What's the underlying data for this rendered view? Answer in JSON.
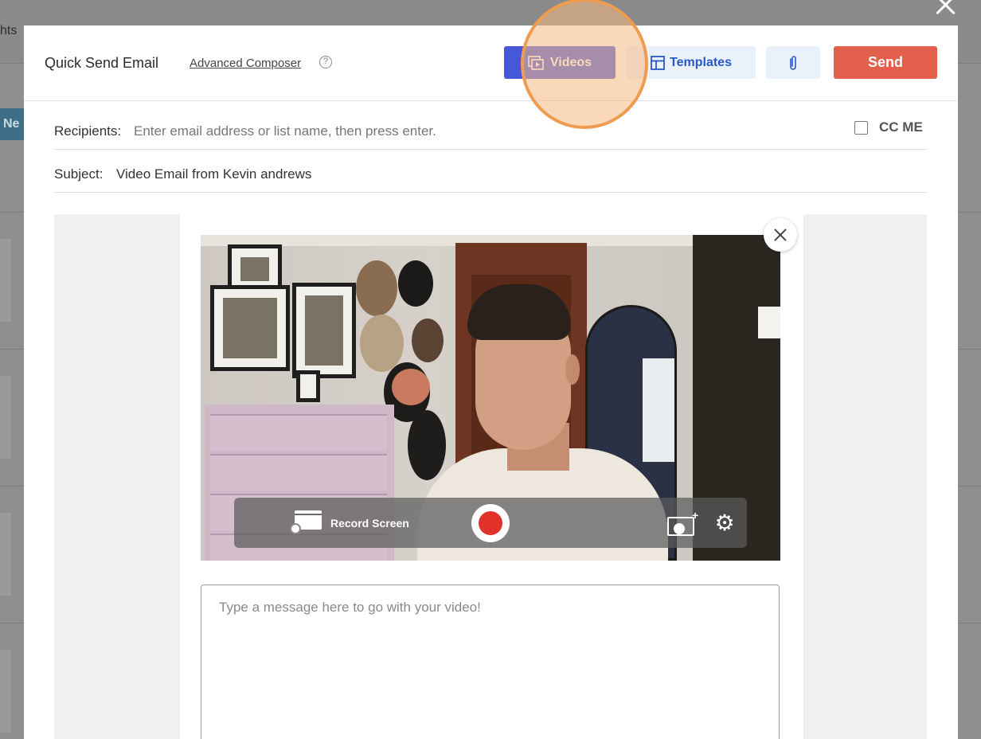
{
  "backdrop": {
    "tab_text": "hts",
    "new_button": "Ne"
  },
  "modal": {
    "title": "Quick Send Email",
    "advanced_link": "Advanced Composer",
    "help_symbol": "?",
    "buttons": {
      "videos": "Videos",
      "templates": "Templates",
      "send": "Send"
    },
    "recipients": {
      "label": "Recipients:",
      "placeholder": "Enter email address or list name, then press enter."
    },
    "cc_me_label": "CC ME",
    "subject": {
      "label": "Subject:",
      "value": "Video Email from Kevin andrews"
    },
    "recorder": {
      "record_screen_label": "Record Screen"
    },
    "message": {
      "placeholder": "Type a message here to go with your video!"
    }
  },
  "icons": {
    "videos": "video-icon",
    "templates": "layout-icon",
    "attach": "paperclip-icon",
    "record_screen": "screen-record-icon",
    "background": "virtual-background-icon",
    "settings": "gear-icon"
  },
  "colors": {
    "videos_button": "#4657d9",
    "templates_button": "#e9f1fb",
    "send_button": "#e2604c",
    "record_dot": "#e0322a",
    "highlight": "#ee9d50"
  }
}
